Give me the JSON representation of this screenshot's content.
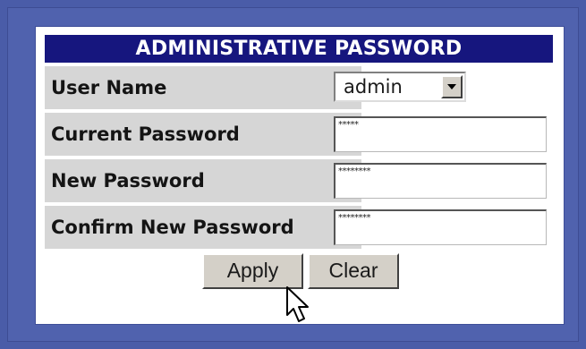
{
  "form": {
    "title": "ADMINISTRATIVE PASSWORD",
    "rows": [
      {
        "label": "User Name",
        "type": "select",
        "value": "admin"
      },
      {
        "label": "Current Password",
        "type": "password",
        "mask": "*****"
      },
      {
        "label": "New Password",
        "type": "password",
        "mask": "********"
      },
      {
        "label": "Confirm New Password",
        "type": "password",
        "mask": "********"
      }
    ],
    "buttons": {
      "apply": "Apply",
      "clear": "Clear"
    }
  },
  "colors": {
    "background": "#4a5ca8",
    "title_bar": "#16167e",
    "label_cell": "#d6d6d6"
  },
  "icons": {
    "select_arrow": "chevron-down-icon",
    "cursor": "mouse-pointer-icon"
  }
}
